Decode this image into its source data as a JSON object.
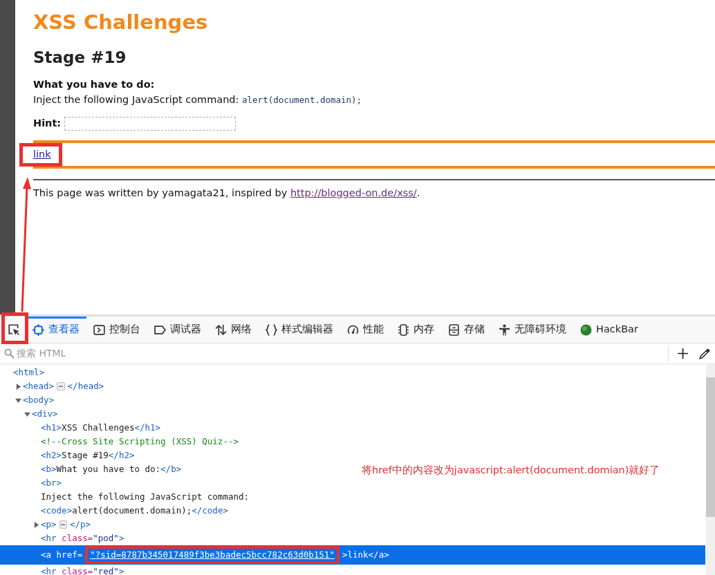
{
  "page": {
    "title": "XSS Challenges",
    "stage": "Stage #19",
    "task_label": "What you have to do:",
    "task_text": "Inject the following JavaScript command:",
    "task_code": "alert(document.domain);",
    "hint_label": "Hint:",
    "link": "link",
    "footer_text": "This page was written by yamagata21, inspired by",
    "footer_link": "http://blogged-on.de/xss/",
    "footer_end": "."
  },
  "devtools": {
    "tabs": [
      {
        "label": "查看器",
        "selected": true
      },
      {
        "label": "控制台",
        "selected": false
      },
      {
        "label": "调试器",
        "selected": false
      },
      {
        "label": "网络",
        "selected": false
      },
      {
        "label": "样式编辑器",
        "selected": false
      },
      {
        "label": "性能",
        "selected": false
      },
      {
        "label": "内存",
        "selected": false
      },
      {
        "label": "存储",
        "selected": false
      },
      {
        "label": "无障碍环境",
        "selected": false
      },
      {
        "label": "HackBar",
        "selected": false
      }
    ],
    "search": {
      "placeholder": "搜索 HTML"
    },
    "tree": [
      {
        "parts": [
          {
            "kind": "tag",
            "text": "<html>"
          }
        ],
        "selected": false,
        "children": [
          {
            "parts": [
              {
                "kind": "tag",
                "text": "<head>"
              },
              {
                "kind": "badge",
                "text": "⋯"
              },
              {
                "kind": "tag",
                "text": "</head>"
              }
            ],
            "expanded": false,
            "selected": false
          },
          {
            "parts": [
              {
                "kind": "tag",
                "text": "<body>"
              }
            ],
            "expanded": true,
            "selected": false,
            "children": [
              {
                "parts": [
                  {
                    "kind": "tag",
                    "text": "<div>"
                  }
                ],
                "expanded": true,
                "selected": false,
                "children": [
                  {
                    "parts": [
                      {
                        "kind": "tag",
                        "text": "<h1>"
                      },
                      {
                        "kind": "text",
                        "text": "XSS Challenges"
                      },
                      {
                        "kind": "tag",
                        "text": "</h1>"
                      }
                    ],
                    "selected": false
                  },
                  {
                    "parts": [
                      {
                        "kind": "comment",
                        "text": "<!--Cross Site Scripting (XSS) Quiz-->"
                      }
                    ],
                    "selected": false
                  },
                  {
                    "parts": [
                      {
                        "kind": "tag",
                        "text": "<h2>"
                      },
                      {
                        "kind": "text",
                        "text": "Stage #19"
                      },
                      {
                        "kind": "tag",
                        "text": "</h2>"
                      }
                    ],
                    "selected": false
                  },
                  {
                    "parts": [
                      {
                        "kind": "tag",
                        "text": "<b>"
                      },
                      {
                        "kind": "text",
                        "text": "What you have to do:"
                      },
                      {
                        "kind": "tag",
                        "text": "</b>"
                      }
                    ],
                    "selected": false
                  },
                  {
                    "parts": [
                      {
                        "kind": "tag",
                        "text": "<br>"
                      }
                    ],
                    "selected": false
                  },
                  {
                    "parts": [
                      {
                        "kind": "text",
                        "text": "Inject the following JavaScript command:"
                      }
                    ],
                    "selected": false
                  },
                  {
                    "parts": [
                      {
                        "kind": "tag",
                        "text": "<code>"
                      },
                      {
                        "kind": "text",
                        "text": "alert(document.domain);"
                      },
                      {
                        "kind": "tag",
                        "text": "</code>"
                      }
                    ],
                    "selected": false
                  },
                  {
                    "parts": [
                      {
                        "kind": "tag",
                        "text": "<p>"
                      },
                      {
                        "kind": "badge",
                        "text": "⋯"
                      },
                      {
                        "kind": "tag",
                        "text": "</p>"
                      }
                    ],
                    "expanded": false,
                    "selected": false
                  },
                  {
                    "parts": [
                      {
                        "kind": "tag",
                        "text": "<hr "
                      },
                      {
                        "kind": "attr",
                        "text": "class="
                      },
                      {
                        "kind": "value",
                        "text": "\"pod\""
                      },
                      {
                        "kind": "tag",
                        "text": ">"
                      }
                    ],
                    "selected": false
                  },
                  {
                    "parts": [
                      {
                        "kind": "tag",
                        "text": "<a "
                      },
                      {
                        "kind": "attr",
                        "text": "href="
                      },
                      {
                        "kind": "link",
                        "text": "\"?sid=8787b345017489f3be3badec5bcc782c63d0b151\""
                      },
                      {
                        "kind": "tag",
                        "text": ">"
                      },
                      {
                        "kind": "text",
                        "text": "link"
                      },
                      {
                        "kind": "tag",
                        "text": "</a>"
                      }
                    ],
                    "selected": true
                  },
                  {
                    "parts": [
                      {
                        "kind": "tag",
                        "text": "<hr "
                      },
                      {
                        "kind": "attr",
                        "text": "class="
                      },
                      {
                        "kind": "value",
                        "text": "\"red\""
                      },
                      {
                        "kind": "tag",
                        "text": ">"
                      }
                    ],
                    "selected": false
                  }
                ]
              }
            ]
          }
        ]
      }
    ]
  },
  "note": "将href中的内容改为javascript:alert(document.domian)就好了"
}
